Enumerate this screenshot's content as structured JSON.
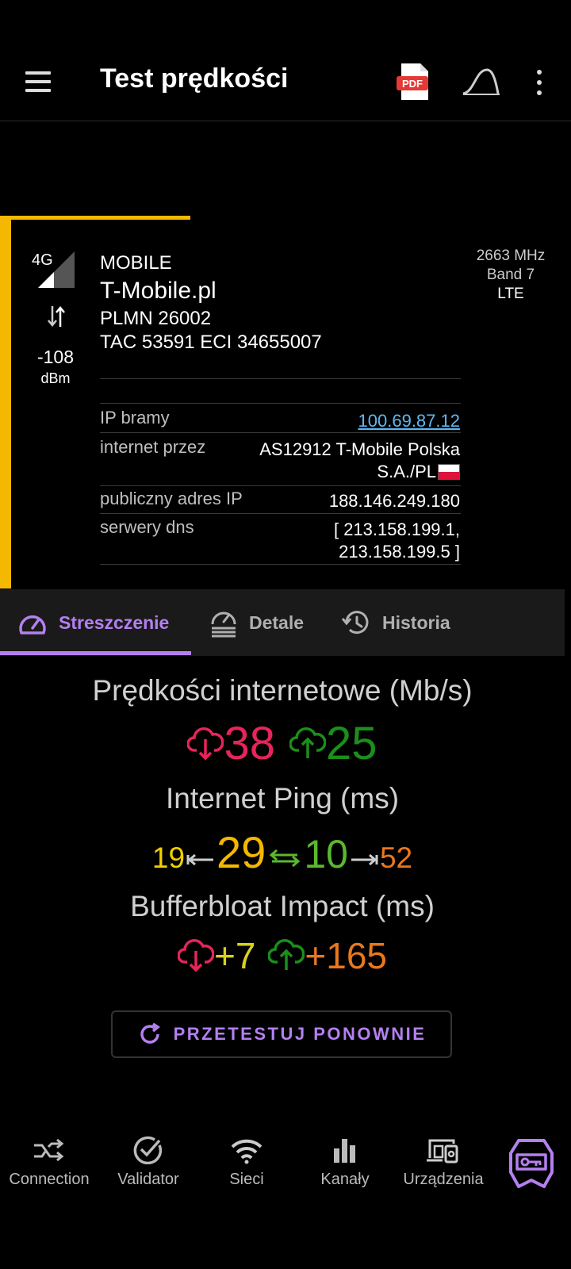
{
  "header": {
    "title": "Test prędkości",
    "pdf_badge": "PDF"
  },
  "network": {
    "type": "4G",
    "signal_value": "-108",
    "signal_unit": "dBm",
    "connection_type": "MOBILE",
    "operator": "T-Mobile.pl",
    "plmn": "PLMN 26002",
    "tac_eci": "TAC 53591 ECI 34655007",
    "frequency": "2663 MHz",
    "band": "Band 7",
    "technology": "LTE",
    "accent_color": "#f5b800",
    "details": {
      "gateway_label": "IP bramy",
      "gateway_value": "100.69.87.12",
      "isp_label": "internet przez",
      "isp_line1": "AS12912 T-Mobile Polska",
      "isp_line2": "S.A./PL",
      "public_ip_label": "publiczny adres IP",
      "public_ip_value": "188.146.249.180",
      "dns_label": "serwery dns",
      "dns_line1": "[ 213.158.199.1,",
      "dns_line2": "213.158.199.5 ]"
    }
  },
  "tabs": {
    "summary": "Streszczenie",
    "details": "Detale",
    "history": "Historia",
    "active_color": "#b480f0"
  },
  "results": {
    "speed_title": "Prędkości internetowe (Mb/s)",
    "download": "38",
    "upload": "25",
    "ping_title": "Internet Ping (ms)",
    "ping_min": "19",
    "ping_median": "29",
    "ping_jitter": "10",
    "ping_max": "52",
    "bloat_title": "Bufferbloat Impact (ms)",
    "bloat_down": "+7",
    "bloat_up": "+165",
    "colors": {
      "download": "#e8245a",
      "upload": "#1a8f1a",
      "ping_min": "#f0d000",
      "ping_median": "#f5b800",
      "ping_jitter": "#5bb82e",
      "ping_max": "#e8781e",
      "bloat_down": "#d8d020",
      "bloat_up": "#e8781e"
    }
  },
  "retest_label": "PRZETESTUJ PONOWNIE",
  "bottom_nav": {
    "connection": "Connection",
    "validator": "Validator",
    "networks": "Sieci",
    "channels": "Kanały",
    "devices": "Urządzenia"
  },
  "icons": {
    "menu": "hamburger-icon",
    "pdf": "pdf-icon",
    "curve": "signal-curve-icon",
    "more": "more-vert-icon",
    "premium": "premium-badge-icon"
  }
}
